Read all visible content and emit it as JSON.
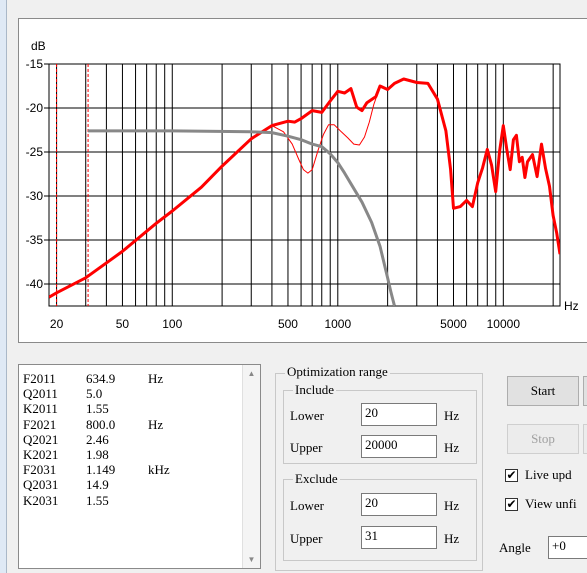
{
  "chart_data": {
    "type": "line",
    "ylabel": "dB",
    "xlabel": "Hz",
    "xscale": "log",
    "xlim": [
      18,
      22000
    ],
    "ylim": [
      -42.5,
      -15
    ],
    "x_tick_labels": [
      "20",
      "50",
      "100",
      "500",
      "1000",
      "5000",
      "10000"
    ],
    "x_tick_values": [
      20,
      50,
      100,
      500,
      1000,
      5000,
      10000
    ],
    "y_tick_labels": [
      "-15",
      "-20",
      "-25",
      "-30",
      "-35",
      "-40"
    ],
    "y_tick_values": [
      -15,
      -20,
      -25,
      -30,
      -35,
      -40
    ],
    "markers_hz": [
      20,
      31
    ],
    "series": [
      {
        "color": "#ff0000",
        "style": "thick",
        "points": [
          [
            18,
            -41.5
          ],
          [
            20,
            -41.0
          ],
          [
            30,
            -39.3
          ],
          [
            50,
            -36.3
          ],
          [
            80,
            -33.1
          ],
          [
            100,
            -31.7
          ],
          [
            150,
            -29.0
          ],
          [
            200,
            -26.6
          ],
          [
            300,
            -23.5
          ],
          [
            400,
            -22.0
          ],
          [
            500,
            -21.5
          ],
          [
            550,
            -21.6
          ],
          [
            600,
            -21.2
          ],
          [
            700,
            -20.3
          ],
          [
            800,
            -20.5
          ],
          [
            900,
            -19.2
          ],
          [
            1000,
            -18.1
          ],
          [
            1100,
            -18.3
          ],
          [
            1200,
            -17.8
          ],
          [
            1300,
            -19.9
          ],
          [
            1400,
            -20.3
          ],
          [
            1500,
            -19.4
          ],
          [
            1700,
            -18.7
          ],
          [
            1800,
            -17.5
          ],
          [
            2000,
            -17.9
          ],
          [
            2200,
            -17.2
          ],
          [
            2500,
            -16.7
          ],
          [
            3000,
            -17.1
          ],
          [
            3500,
            -17.2
          ],
          [
            4000,
            -19.0
          ],
          [
            4500,
            -22.6
          ],
          [
            4800,
            -27.0
          ],
          [
            5000,
            -31.4
          ],
          [
            5500,
            -31.2
          ],
          [
            6000,
            -30.5
          ],
          [
            6500,
            -31.2
          ],
          [
            7000,
            -28.5
          ],
          [
            7500,
            -26.8
          ],
          [
            8000,
            -24.7
          ],
          [
            8500,
            -26.5
          ],
          [
            9000,
            -29.5
          ],
          [
            9500,
            -24.9
          ],
          [
            10000,
            -22.0
          ],
          [
            10500,
            -24.7
          ],
          [
            11000,
            -27.0
          ],
          [
            11500,
            -23.6
          ],
          [
            12000,
            -23.1
          ],
          [
            12500,
            -26.1
          ],
          [
            13000,
            -25.6
          ],
          [
            13500,
            -27.9
          ],
          [
            14000,
            -26.1
          ],
          [
            15000,
            -25.3
          ],
          [
            16000,
            -27.8
          ],
          [
            17000,
            -24.1
          ],
          [
            18000,
            -26.9
          ],
          [
            19000,
            -28.9
          ],
          [
            20000,
            -32.2
          ],
          [
            21000,
            -34.2
          ],
          [
            22000,
            -36.6
          ]
        ]
      },
      {
        "color": "#ff0000",
        "style": "thin",
        "points": [
          [
            300,
            -23.5
          ],
          [
            400,
            -22.0
          ],
          [
            470,
            -22.7
          ],
          [
            530,
            -24.1
          ],
          [
            580,
            -25.8
          ],
          [
            620,
            -27.0
          ],
          [
            660,
            -27.4
          ],
          [
            700,
            -27.0
          ],
          [
            760,
            -24.8
          ],
          [
            820,
            -23.0
          ],
          [
            880,
            -21.9
          ],
          [
            950,
            -21.9
          ],
          [
            1050,
            -22.7
          ],
          [
            1150,
            -23.4
          ],
          [
            1250,
            -24.1
          ],
          [
            1350,
            -24.2
          ],
          [
            1450,
            -23.3
          ],
          [
            1550,
            -21.6
          ],
          [
            1650,
            -19.6
          ],
          [
            1800,
            -17.6
          ]
        ]
      },
      {
        "color": "#888888",
        "style": "thick",
        "points": [
          [
            31,
            -22.6
          ],
          [
            100,
            -22.6
          ],
          [
            300,
            -22.7
          ],
          [
            400,
            -22.8
          ],
          [
            500,
            -23.2
          ],
          [
            600,
            -23.6
          ],
          [
            700,
            -24.1
          ],
          [
            800,
            -24.4
          ],
          [
            900,
            -25.2
          ],
          [
            1000,
            -26.2
          ],
          [
            1100,
            -27.4
          ],
          [
            1200,
            -28.6
          ],
          [
            1400,
            -30.7
          ],
          [
            1600,
            -33.0
          ],
          [
            1800,
            -35.7
          ],
          [
            2000,
            -39.3
          ],
          [
            2100,
            -41.0
          ],
          [
            2200,
            -42.5
          ]
        ]
      }
    ]
  },
  "params": {
    "rows": [
      [
        "F2011",
        "634.9",
        "Hz"
      ],
      [
        "Q2011",
        "5.0",
        ""
      ],
      [
        "K2011",
        "1.55",
        ""
      ],
      [
        "F2021",
        "800.0",
        "Hz"
      ],
      [
        "Q2021",
        "2.46",
        ""
      ],
      [
        "K2021",
        "1.98",
        ""
      ],
      [
        "F2031",
        "1.149",
        "kHz"
      ],
      [
        "Q2031",
        "14.9",
        ""
      ],
      [
        "K2031",
        "1.55",
        ""
      ]
    ]
  },
  "optimization": {
    "title": "Optimization range",
    "include": {
      "title": "Include",
      "lower_label": "Lower",
      "lower_value": "20",
      "lower_unit": "Hz",
      "upper_label": "Upper",
      "upper_value": "20000",
      "upper_unit": "Hz"
    },
    "exclude": {
      "title": "Exclude",
      "lower_label": "Lower",
      "lower_value": "20",
      "lower_unit": "Hz",
      "upper_label": "Upper",
      "upper_value": "31",
      "upper_unit": "Hz"
    }
  },
  "controls": {
    "start_label": "Start",
    "stop_label": "Stop",
    "live_update_label": "Live upd",
    "live_update_checked": true,
    "view_unfiltered_label": "View unfi",
    "view_unfiltered_checked": true,
    "angle_label": "Angle",
    "angle_value": "+0"
  }
}
